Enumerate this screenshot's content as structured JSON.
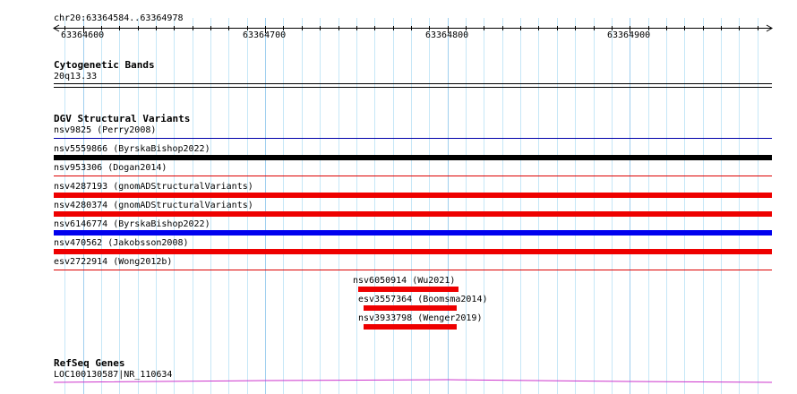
{
  "ruler": {
    "region_label": "chr20:63364584..63364978",
    "start": 63364584,
    "end": 63364978,
    "ticks": [
      {
        "pos": 63364600,
        "label": "63364600"
      },
      {
        "pos": 63364700,
        "label": "63364700"
      },
      {
        "pos": 63364800,
        "label": "63364800"
      },
      {
        "pos": 63364900,
        "label": "63364900"
      }
    ]
  },
  "tracks": {
    "cyto": {
      "title": "Cytogenetic Bands",
      "features": [
        {
          "label": "20q13.33",
          "start": 63364584,
          "end": 63364978,
          "color": "#000000",
          "style": "double"
        }
      ]
    },
    "dgv": {
      "title": "DGV Structural Variants",
      "features": [
        {
          "label": "nsv9825 (Perry2008)",
          "start": 63364584,
          "end": 63364978,
          "color": "#0000aa",
          "style": "thin"
        },
        {
          "label": "nsv5559866 (ByrskaBishop2022)",
          "start": 63364584,
          "end": 63364978,
          "color": "#000000",
          "style": "thick"
        },
        {
          "label": "nsv953306 (Dogan2014)",
          "start": 63364584,
          "end": 63364978,
          "color": "#dd0000",
          "style": "thin"
        },
        {
          "label": "nsv4287193 (gnomADStructuralVariants)",
          "start": 63364584,
          "end": 63364978,
          "color": "#ee0000",
          "style": "thick"
        },
        {
          "label": "nsv4280374 (gnomADStructuralVariants)",
          "start": 63364584,
          "end": 63364978,
          "color": "#ee0000",
          "style": "thick"
        },
        {
          "label": "nsv6146774 (ByrskaBishop2022)",
          "start": 63364584,
          "end": 63364978,
          "color": "#0000ee",
          "style": "thick"
        },
        {
          "label": "nsv470562 (Jakobsson2008)",
          "start": 63364584,
          "end": 63364978,
          "color": "#ee0000",
          "style": "thick"
        },
        {
          "label": "esv2722914 (Wong2012b)",
          "start": 63364584,
          "end": 63364978,
          "color": "#dd0000",
          "style": "thin"
        },
        {
          "label": "nsv6050914 (Wu2021)",
          "start": 63364751,
          "end": 63364806,
          "color": "#ee0000",
          "style": "thick"
        },
        {
          "label": "esv3557364 (Boomsma2014)",
          "start": 63364754,
          "end": 63364805,
          "color": "#ee0000",
          "style": "thick"
        },
        {
          "label": "nsv3933798 (Wenger2019)",
          "start": 63364754,
          "end": 63364805,
          "color": "#ee0000",
          "style": "thick"
        }
      ]
    },
    "refseq": {
      "title": "RefSeq Genes",
      "features": [
        {
          "label": "LOC100130587|NR_110634",
          "start": 63364584,
          "end": 63364978,
          "color": "#cc33cc",
          "style": "intron"
        }
      ]
    }
  }
}
